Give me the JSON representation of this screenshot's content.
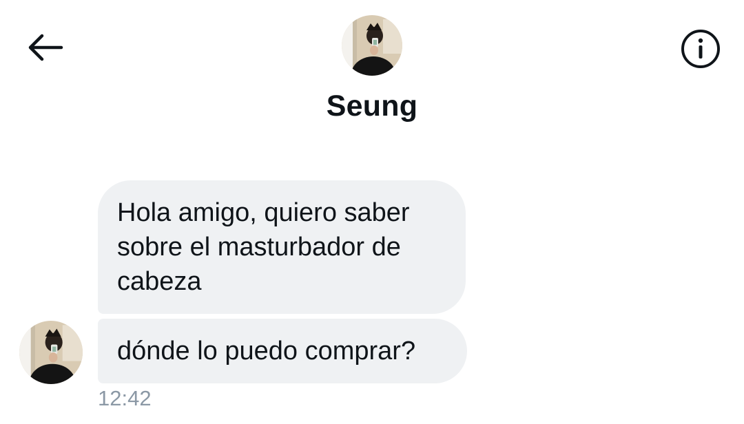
{
  "header": {
    "contact_name": "Seung",
    "back_icon": "arrow-left-icon",
    "info_icon": "info-circle-icon"
  },
  "messages": [
    {
      "text": "Hola amigo, quiero saber sobre el masturbador de cabeza"
    },
    {
      "text": "dónde lo puedo comprar?"
    }
  ],
  "timestamp": "12:42",
  "colors": {
    "bubble_background": "#eff1f3",
    "text": "#0f1419",
    "timestamp": "#8b98a5",
    "background": "#ffffff"
  }
}
